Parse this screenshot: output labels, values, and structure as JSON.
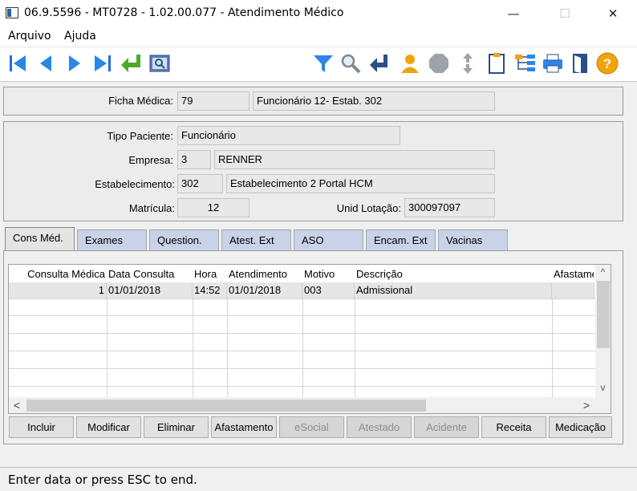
{
  "window": {
    "title": "06.9.5596 - MT0728 - 1.02.00.077 - Atendimento Médico",
    "minimize": "—",
    "maximize": "☐",
    "close": "✕"
  },
  "menu": [
    "Arquivo",
    "Ajuda"
  ],
  "toolbar_icons": [
    "first-record-icon",
    "prev-record-icon",
    "next-record-icon",
    "last-record-icon",
    "return-icon",
    "zoom-search-icon",
    "filter-icon",
    "search-icon",
    "go-to-icon",
    "user-icon",
    "stop-icon",
    "sort-icon",
    "clipboard-icon",
    "hierarchy-icon",
    "print-icon",
    "exit-door-icon",
    "help-icon"
  ],
  "header": {
    "ficha_label": "Ficha Médica:",
    "ficha_value": "79",
    "ficha_desc": "Funcionário 12- Estab. 302"
  },
  "patient": {
    "tipo_label": "Tipo Paciente:",
    "tipo_value": "Funcionário",
    "empresa_label": "Empresa:",
    "empresa_code": "3",
    "empresa_name": "RENNER",
    "estab_label": "Estabelecimento:",
    "estab_code": "302",
    "estab_name": "Estabelecimento 2 Portal HCM",
    "matricula_label": "Matrícula:",
    "matricula_value": "12",
    "unid_label": "Unid Lotação:",
    "unid_value": "300097097"
  },
  "tabs": [
    "Cons Méd.",
    "Exames",
    "Question.",
    "Atest. Ext",
    "ASO",
    "Encam. Ext",
    "Vacinas"
  ],
  "table": {
    "columns": [
      "Consulta Médica",
      "Data Consulta",
      "Hora",
      "Atendimento",
      "Motivo",
      "Descrição",
      "Afastame"
    ],
    "rows": [
      [
        "1",
        "01/01/2018",
        "14:52",
        "01/01/2018",
        "003",
        "Admissional",
        ""
      ]
    ]
  },
  "scroll": {
    "up": "^",
    "down": "v",
    "left": "<",
    "right": ">"
  },
  "buttons": [
    {
      "label": "Incluir",
      "enabled": true
    },
    {
      "label": "Modificar",
      "enabled": true
    },
    {
      "label": "Eliminar",
      "enabled": true
    },
    {
      "label": "Afastamento",
      "enabled": true
    },
    {
      "label": "eSocial",
      "enabled": false
    },
    {
      "label": "Atestado",
      "enabled": false
    },
    {
      "label": "Acidente",
      "enabled": false
    },
    {
      "label": "Receita",
      "enabled": true
    },
    {
      "label": "Medicação",
      "enabled": true
    }
  ],
  "status": "Enter data or press ESC to end."
}
